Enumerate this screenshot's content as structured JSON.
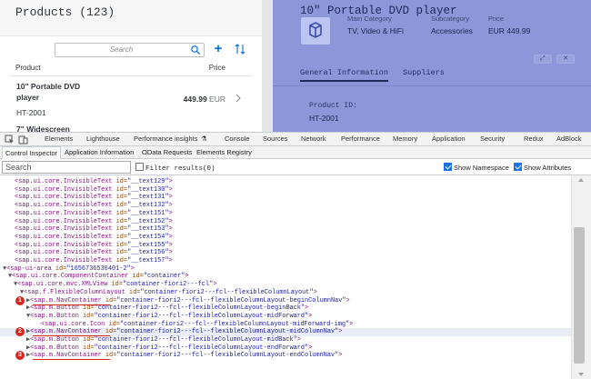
{
  "app": {
    "list": {
      "title": "Products (123)",
      "search_placeholder": "Search",
      "col_product": "Product",
      "col_price": "Price",
      "item1": {
        "name": "10\" Portable DVD player",
        "id": "HT-2001",
        "price_value": "449.99",
        "price_unit": "EUR"
      },
      "item2": {
        "name": "7\" Widescreen"
      }
    },
    "detail": {
      "title": "10\" Portable DVD player",
      "attrs": [
        {
          "label": "Main Category",
          "value": "TV, Video & HiFi"
        },
        {
          "label": "Subcategory",
          "value": "Accessories"
        },
        {
          "label": "Price",
          "value": "EUR 449.99"
        }
      ],
      "action_icons": [
        "fullscreen-icon",
        "close-icon"
      ],
      "tabs": [
        "General Information",
        "Suppliers"
      ],
      "product_id_label": "Product ID:",
      "product_id_value": "HT-2001"
    }
  },
  "devtools": {
    "tabs": [
      "Elements",
      "Lighthouse",
      "Performance insights",
      "Console",
      "Sources",
      "Network",
      "Performance",
      "Memory",
      "Application",
      "Security",
      "Redux",
      "AdBlock"
    ],
    "ui5_tabs": [
      "Control Inspector",
      "Application Information",
      "OData Requests",
      "Elements Registry"
    ],
    "search_placeholder": "Search",
    "filter_label": "Filter results(0)",
    "show_namespace_label": "Show Namespace",
    "show_attributes_label": "Show Attributes",
    "show_namespace_checked": true,
    "show_attributes_checked": true,
    "filter_checked": false
  },
  "tree": {
    "invisible_lines": [
      {
        "tag": "sap.ui.core.InvisibleText",
        "id": "__text129"
      },
      {
        "tag": "sap.ui.core.InvisibleText",
        "id": "__text130"
      },
      {
        "tag": "sap.ui.core.InvisibleText",
        "id": "__text131"
      },
      {
        "tag": "sap.ui.core.InvisibleText",
        "id": "__text132"
      },
      {
        "tag": "sap.ui.core.InvisibleText",
        "id": "__text151"
      },
      {
        "tag": "sap.ui.core.InvisibleText",
        "id": "__text152"
      },
      {
        "tag": "sap.ui.core.InvisibleText",
        "id": "__text153"
      },
      {
        "tag": "sap.ui.core.InvisibleText",
        "id": "__text154"
      },
      {
        "tag": "sap.ui.core.InvisibleText",
        "id": "__text155"
      },
      {
        "tag": "sap.ui.core.InvisibleText",
        "id": "__text156"
      },
      {
        "tag": "sap.ui.core.InvisibleText",
        "id": "__text157"
      }
    ],
    "structure_lines": [
      {
        "tag": "sap-ui-area",
        "id": "1656736530401-2",
        "open": true
      },
      {
        "tag": "sap.ui.core.ComponentContainer",
        "id": "container",
        "open": true
      },
      {
        "tag": "sap.ui.core.mvc.XMLView",
        "id": "container-fiori2---fcl",
        "open": true
      },
      {
        "tag": "sap.f.FlexibleColumnLayout",
        "id": "container-fiori2---fcl--flexibleColumnLayout",
        "open": true
      },
      {
        "tag": "sap.m.NavContainer",
        "id": "container-fiori2---fcl--flexibleColumnLayout-beginColumnNav",
        "open": false,
        "marker": "1"
      },
      {
        "tag": "sap.m.Button",
        "id": "container-fiori2---fcl--flexibleColumnLayout-beginBack",
        "open": false
      },
      {
        "tag": "sap.m.Button",
        "id": "container-fiori2---fcl--flexibleColumnLayout-midForward",
        "open": true
      },
      {
        "tag": "sap.ui.core.Icon",
        "id": "container-fiori2---fcl--flexibleColumnLayout-midForward-img",
        "open": null
      },
      {
        "tag": "sap.m.NavContainer",
        "id": "container-fiori2---fcl--flexibleColumnLayout-midColumnNav",
        "open": false,
        "marker": "2",
        "highlight": true
      },
      {
        "tag": "sap.m.Button",
        "id": "container-fiori2---fcl--flexibleColumnLayout-midBack",
        "open": false
      },
      {
        "tag": "sap.m.Button",
        "id": "container-fiori2---fcl--flexibleColumnLayout-endForward",
        "open": false
      },
      {
        "tag": "sap.m.NavContainer",
        "id": "container-fiori2---fcl--flexibleColumnLayout-endColumnNav",
        "open": false,
        "marker": "3"
      }
    ],
    "colors": {
      "tag": "#881280",
      "attr_name": "#994500",
      "attr_value": "#1a1aa6",
      "marker": "#d7261e",
      "detail_bg": "#8d96d8"
    }
  }
}
